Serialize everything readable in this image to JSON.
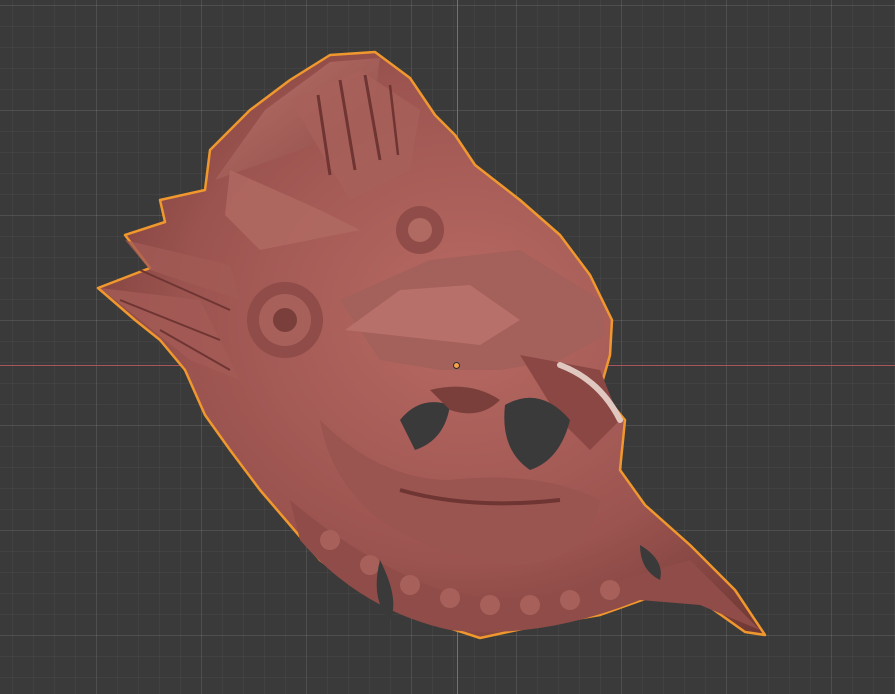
{
  "viewport": {
    "background": "#3a3a3a",
    "grid": true,
    "x_axis_color": "#a8555e",
    "y_axis_color": "#4d7ba6"
  },
  "object": {
    "name_icon": "mask-mesh",
    "material_color": "#9c5450",
    "selection_outline_color": "#f0982e",
    "selected": true
  }
}
